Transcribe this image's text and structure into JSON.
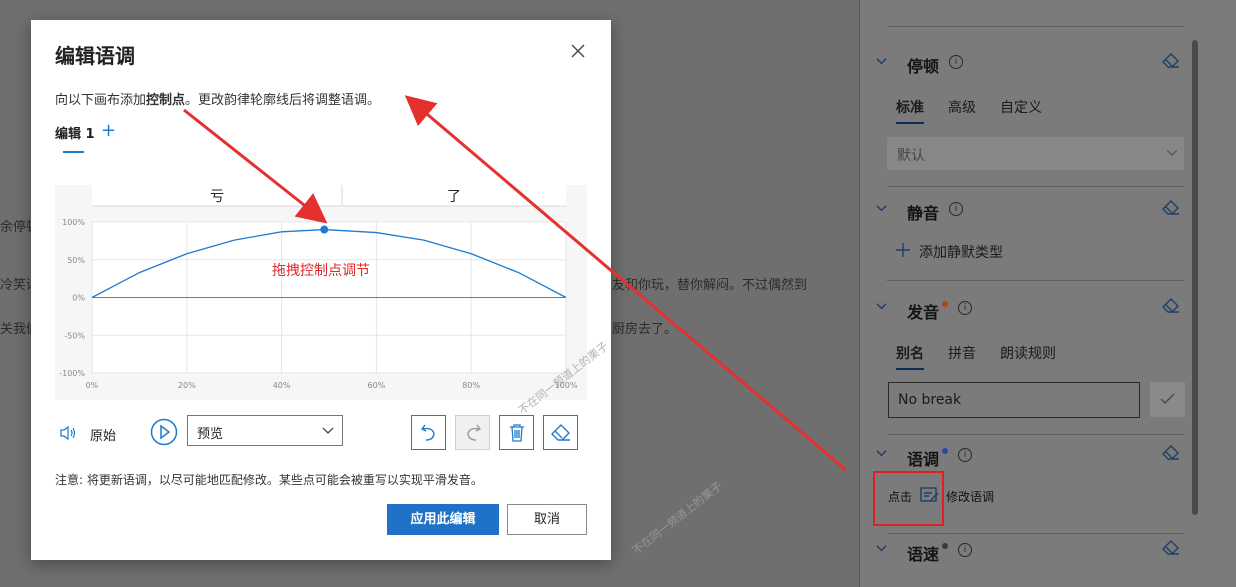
{
  "background": {
    "lines": [
      {
        "text": "余停顿"
      },
      {
        "text": "冷笑话"
      },
      {
        "text": "关我们"
      },
      {
        "text": "友和你玩，替你解闷。不过偶然到"
      },
      {
        "text": "厨房去了。"
      }
    ]
  },
  "right_panel": {
    "sections": {
      "pause": {
        "title": "停顿",
        "tabs": [
          "标准",
          "高级",
          "自定义"
        ],
        "dropdown_value": "默认"
      },
      "silence": {
        "title": "静音",
        "add_label": "添加静默类型"
      },
      "pronunciation": {
        "title": "发音",
        "tabs": [
          "别名",
          "拼音",
          "朗读规则"
        ],
        "input_value": "No break"
      },
      "intonation": {
        "title": "语调",
        "hint_prefix": "点击",
        "hint_suffix": "修改语调"
      },
      "speed": {
        "title": "语速"
      }
    },
    "dot_colors": {
      "pronunciation": "#b8400e",
      "intonation": "#2748a8",
      "speed": "#3a3a3a"
    }
  },
  "dialog": {
    "title": "编辑语调",
    "description_prefix": "向以下画布添加",
    "description_bold": "控制点",
    "description_suffix": "。更改韵律轮廓线后将调整语调。",
    "tab_label": "编辑 1",
    "original_label": "原始",
    "preview_select": "预览",
    "note": "注意: 将更新语调，以尽可能地匹配修改。某些点可能会被重写以实现平滑发音。",
    "apply_button": "应用此编辑",
    "cancel_button": "取消",
    "annotation": "拖拽控制点调节",
    "accent_color": "#1f7ad0"
  },
  "chart_data": {
    "type": "line",
    "columns": [
      "亏",
      "了"
    ],
    "x_ticks": [
      "0%",
      "20%",
      "40%",
      "60%",
      "80%",
      "100%"
    ],
    "y_ticks": [
      "100%",
      "50%",
      "0%",
      "-50%",
      "-100%"
    ],
    "xlim": [
      0,
      100
    ],
    "ylim": [
      -100,
      100
    ],
    "series": [
      {
        "values": [
          {
            "x": 0,
            "y": 0
          },
          {
            "x": 10,
            "y": 33
          },
          {
            "x": 20,
            "y": 58
          },
          {
            "x": 30,
            "y": 76
          },
          {
            "x": 40,
            "y": 87
          },
          {
            "x": 49,
            "y": 90
          },
          {
            "x": 60,
            "y": 86
          },
          {
            "x": 70,
            "y": 76
          },
          {
            "x": 80,
            "y": 58
          },
          {
            "x": 90,
            "y": 33
          },
          {
            "x": 100,
            "y": 0
          }
        ]
      },
      {
        "values": [
          {
            "x": 0,
            "y": 0
          },
          {
            "x": 100,
            "y": 0
          }
        ]
      }
    ],
    "control_point": {
      "x": 49,
      "y": 90
    },
    "grid": true
  },
  "watermark": "不在同一频道上的栗子"
}
